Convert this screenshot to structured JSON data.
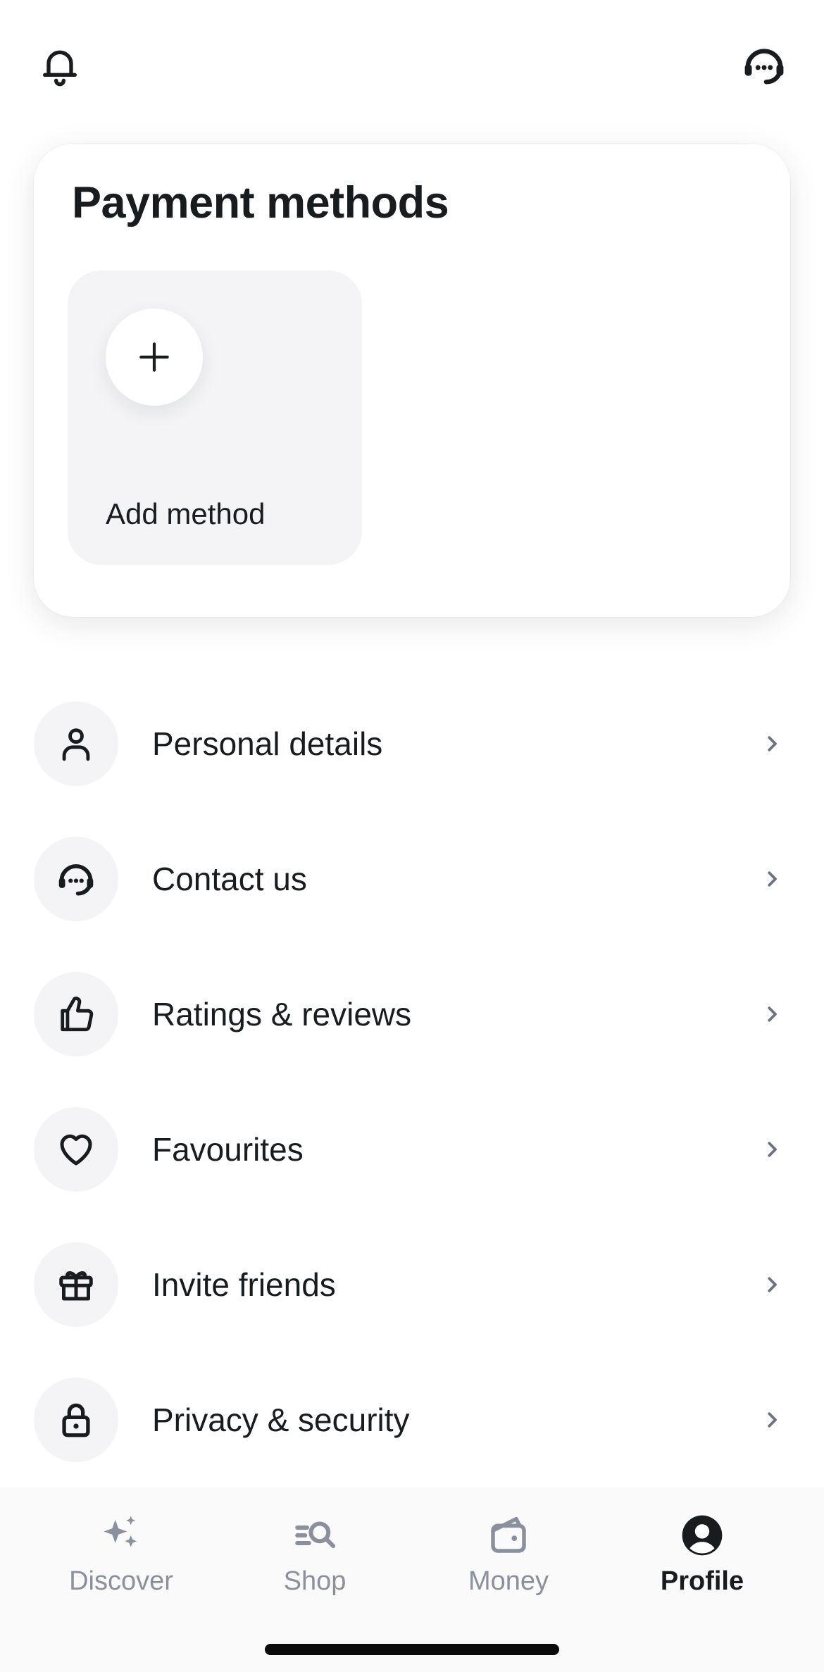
{
  "header": {
    "left_icon": "bell-icon",
    "right_icon": "support-headset-icon"
  },
  "payment_methods": {
    "title": "Payment methods",
    "add_tile": {
      "label": "Add method",
      "icon": "plus-icon"
    }
  },
  "menu": {
    "items": [
      {
        "label": "Personal details",
        "icon": "person-icon"
      },
      {
        "label": "Contact us",
        "icon": "support-headset-icon"
      },
      {
        "label": "Ratings & reviews",
        "icon": "thumbs-up-icon"
      },
      {
        "label": "Favourites",
        "icon": "heart-icon"
      },
      {
        "label": "Invite friends",
        "icon": "gift-icon"
      },
      {
        "label": "Privacy & security",
        "icon": "lock-icon"
      }
    ]
  },
  "bottom_nav": {
    "items": [
      {
        "label": "Discover",
        "icon": "sparkles-icon",
        "active": false
      },
      {
        "label": "Shop",
        "icon": "shop-search-icon",
        "active": false
      },
      {
        "label": "Money",
        "icon": "wallet-icon",
        "active": false
      },
      {
        "label": "Profile",
        "icon": "profile-icon",
        "active": true
      }
    ]
  },
  "colors": {
    "text_primary": "#191c1f",
    "text_muted": "#8b919c",
    "icon_bg": "#f4f4f6",
    "nav_bg": "#fafafb"
  }
}
